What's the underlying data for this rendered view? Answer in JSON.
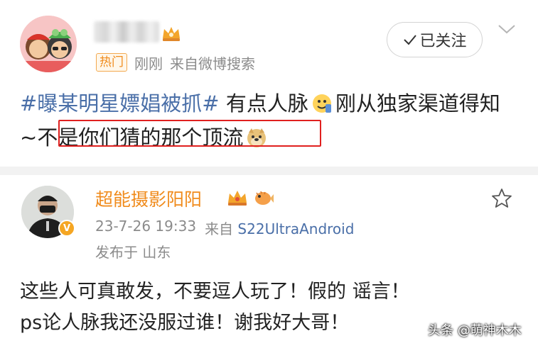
{
  "post": {
    "follow_label": "已关注",
    "hot_badge": "热门",
    "time": "刚刚",
    "source": "来自微博搜索",
    "hashtag": "#曝某明星嫖娼被抓#",
    "text_part1": " 有点人脉",
    "text_part2": "刚从独家渠道得知~",
    "highlighted_text": "不是你们猜的那个顶流"
  },
  "comment": {
    "username": "超能摄影阳阳",
    "datetime": "23-7-26 19:33",
    "source_prefix": "来自",
    "device": "S22UltraAndroid",
    "location": "发布于 山东",
    "line1": "这些人可真敢发，不要逗人玩了！假的 谣言！",
    "line2": "ps论人脉我还没服过谁！谢我好大哥！"
  },
  "watermark": "头条 @萌神木木",
  "colors": {
    "hashtag": "#4a6fa8",
    "username": "#f08b1c",
    "highlight_border": "#e0201f",
    "meta_gray": "#8b8b8b"
  },
  "icons": [
    "cartoon-avatar-icon",
    "crown-icon",
    "check-icon",
    "chevron-down-icon",
    "contact-emoji-icon",
    "doge-emoji-icon",
    "v-verified-icon",
    "blowfish-icon",
    "star-icon"
  ]
}
